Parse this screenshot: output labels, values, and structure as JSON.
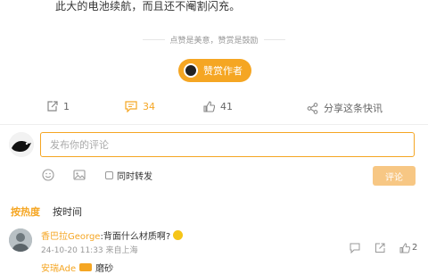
{
  "article": {
    "tail_text": "此大的电池续航，而且还不阉割闪充。"
  },
  "reward": {
    "divider_text": "点赞是美意，赞赏是鼓励",
    "button_label": "赞赏作者"
  },
  "stats": {
    "share_count": "1",
    "comment_count": "34",
    "like_count": "41",
    "share_label": "分享这条快讯"
  },
  "comment_box": {
    "placeholder": "发布你的评论",
    "forward_label": "同时转发",
    "submit_label": "评论"
  },
  "sort": {
    "tabs": [
      "按热度",
      "按时间"
    ],
    "active": "按热度"
  },
  "comments": [
    {
      "user": "香巴拉George",
      "text": ":背面什么材质啊?",
      "meta": "24-10-20 11:33 来自上海",
      "likes": "2"
    },
    {
      "user": "安瑞Ade",
      "text": "磨砂"
    }
  ],
  "colors": {
    "accent": "#f5a623",
    "submit_bg": "#f7c784"
  }
}
